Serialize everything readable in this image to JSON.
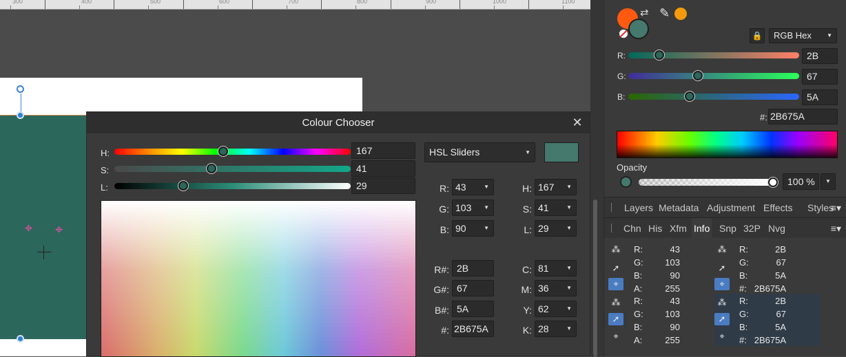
{
  "ruler": {
    "labels": [
      "300",
      "400",
      "500",
      "600",
      "700",
      "800",
      "900",
      "1000",
      "1100"
    ]
  },
  "dialog": {
    "title": "Colour Chooser",
    "close_icon": "close-icon",
    "sliders": [
      {
        "label": "H:",
        "value": "167"
      },
      {
        "label": "S:",
        "value": "41"
      },
      {
        "label": "L:",
        "value": "29"
      }
    ],
    "mode": "HSL Sliders",
    "swatch_color": "#45796e",
    "rgb": [
      {
        "label": "R:",
        "value": "43"
      },
      {
        "label": "G:",
        "value": "103"
      },
      {
        "label": "B:",
        "value": "90"
      }
    ],
    "hsl": [
      {
        "label": "H:",
        "value": "167"
      },
      {
        "label": "S:",
        "value": "41"
      },
      {
        "label": "L:",
        "value": "29"
      }
    ],
    "hex": [
      {
        "label": "R#:",
        "value": "2B"
      },
      {
        "label": "G#:",
        "value": "67"
      },
      {
        "label": "B#:",
        "value": "5A"
      },
      {
        "label": "#:",
        "value": "2B675A"
      }
    ],
    "cmyk": [
      {
        "label": "C:",
        "value": "81"
      },
      {
        "label": "M:",
        "value": "36"
      },
      {
        "label": "Y:",
        "value": "62"
      },
      {
        "label": "K:",
        "value": "28"
      }
    ]
  },
  "colour_panel": {
    "fill_color": "#ff5a0f",
    "stroke_color": "#45796e",
    "picked_color": "#f59a0b",
    "model": "RGB Hex",
    "channels": [
      {
        "label": "R:",
        "value": "2B"
      },
      {
        "label": "G:",
        "value": "67"
      },
      {
        "label": "B:",
        "value": "5A"
      }
    ],
    "hex_label": "#:",
    "hex_value": "2B675A",
    "opacity_label": "Opacity",
    "opacity_value": "100 %"
  },
  "tabs_top": [
    "Layers",
    "Metadata",
    "Adjustment",
    "Effects",
    "Styles"
  ],
  "tabs_bottom": [
    "Chn",
    "His",
    "Xfm",
    "Info",
    "Snp",
    "32P",
    "Nvg"
  ],
  "tabs_bottom_active": "Info",
  "info": {
    "left": [
      [
        {
          "label": "R:",
          "value": "43"
        },
        {
          "label": "G:",
          "value": "103"
        },
        {
          "label": "B:",
          "value": "90"
        },
        {
          "label": "A:",
          "value": "255"
        }
      ],
      [
        {
          "label": "R:",
          "value": "43"
        },
        {
          "label": "G:",
          "value": "103"
        },
        {
          "label": "B:",
          "value": "90"
        },
        {
          "label": "A:",
          "value": "255"
        }
      ]
    ],
    "right": [
      [
        {
          "label": "R:",
          "value": "2B"
        },
        {
          "label": "G:",
          "value": "67"
        },
        {
          "label": "B:",
          "value": "5A"
        },
        {
          "label": "#:",
          "value": "2B675A"
        }
      ],
      [
        {
          "label": "R:",
          "value": "2B"
        },
        {
          "label": "G:",
          "value": "67"
        },
        {
          "label": "B:",
          "value": "5A"
        },
        {
          "label": "#:",
          "value": "2B675A"
        }
      ]
    ]
  }
}
